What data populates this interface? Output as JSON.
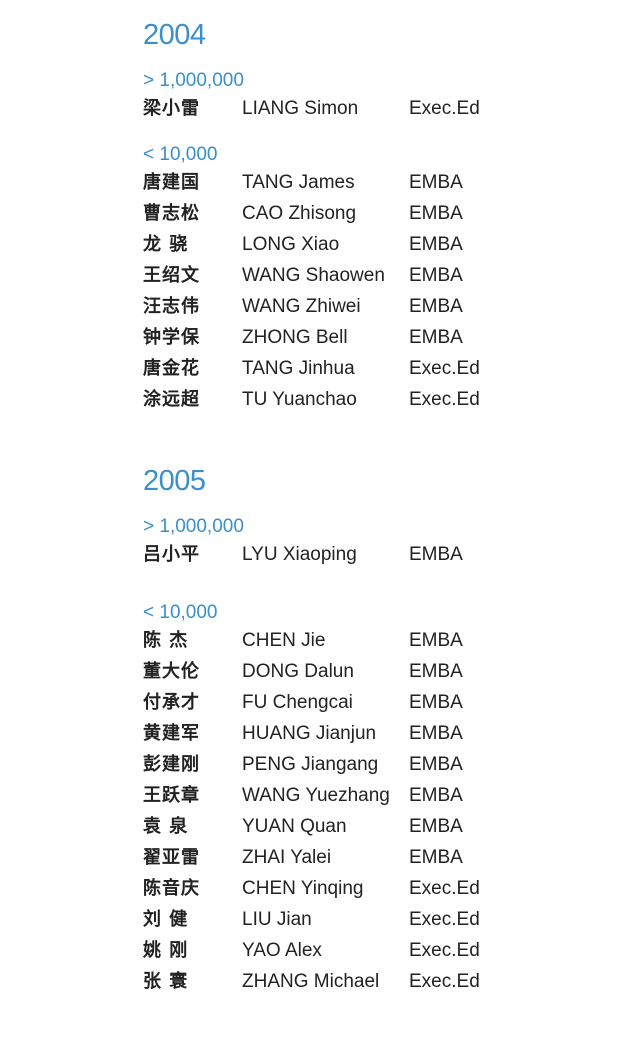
{
  "sections": [
    {
      "year": "2004",
      "groups": [
        {
          "label": "> 1,000,000",
          "rows": [
            {
              "cn": "梁小雷",
              "en": "LIANG Simon",
              "program": "Exec.Ed"
            }
          ]
        },
        {
          "label": "< 10,000",
          "rows": [
            {
              "cn": "唐建国",
              "en": "TANG James",
              "program": "EMBA"
            },
            {
              "cn": "曹志松",
              "en": "CAO Zhisong",
              "program": "EMBA"
            },
            {
              "cn": "龙 骁",
              "en": "LONG Xiao",
              "program": "EMBA"
            },
            {
              "cn": "王绍文",
              "en": "WANG Shaowen",
              "program": "EMBA"
            },
            {
              "cn": "汪志伟",
              "en": "WANG Zhiwei",
              "program": "EMBA"
            },
            {
              "cn": "钟学保",
              "en": "ZHONG Bell",
              "program": "EMBA"
            },
            {
              "cn": "唐金花",
              "en": "TANG Jinhua",
              "program": "Exec.Ed"
            },
            {
              "cn": "涂远超",
              "en": "TU Yuanchao",
              "program": "Exec.Ed"
            }
          ]
        }
      ]
    },
    {
      "year": "2005",
      "groups": [
        {
          "label": "> 1,000,000",
          "rows": [
            {
              "cn": "吕小平",
              "en": "LYU Xiaoping",
              "program": "EMBA"
            }
          ]
        },
        {
          "label": "< 10,000",
          "rows": [
            {
              "cn": "陈 杰",
              "en": "CHEN Jie",
              "program": "EMBA"
            },
            {
              "cn": "董大伦",
              "en": "DONG Dalun",
              "program": "EMBA"
            },
            {
              "cn": "付承才",
              "en": "FU Chengcai",
              "program": "EMBA"
            },
            {
              "cn": "黄建军",
              "en": "HUANG Jianjun",
              "program": "EMBA"
            },
            {
              "cn": "彭建刚",
              "en": "PENG Jiangang",
              "program": "EMBA"
            },
            {
              "cn": "王跃章",
              "en": "WANG Yuezhang",
              "program": "EMBA"
            },
            {
              "cn": "袁 泉",
              "en": "YUAN Quan",
              "program": "EMBA"
            },
            {
              "cn": "翟亚雷",
              "en": "ZHAI Yalei",
              "program": "EMBA"
            },
            {
              "cn": "陈音庆",
              "en": "CHEN Yinqing",
              "program": "Exec.Ed"
            },
            {
              "cn": "刘 健",
              "en": "LIU Jian",
              "program": "Exec.Ed"
            },
            {
              "cn": "姚 刚",
              "en": "YAO Alex",
              "program": "Exec.Ed"
            },
            {
              "cn": "张 寰",
              "en": "ZHANG Michael",
              "program": "Exec.Ed"
            }
          ]
        }
      ]
    }
  ]
}
